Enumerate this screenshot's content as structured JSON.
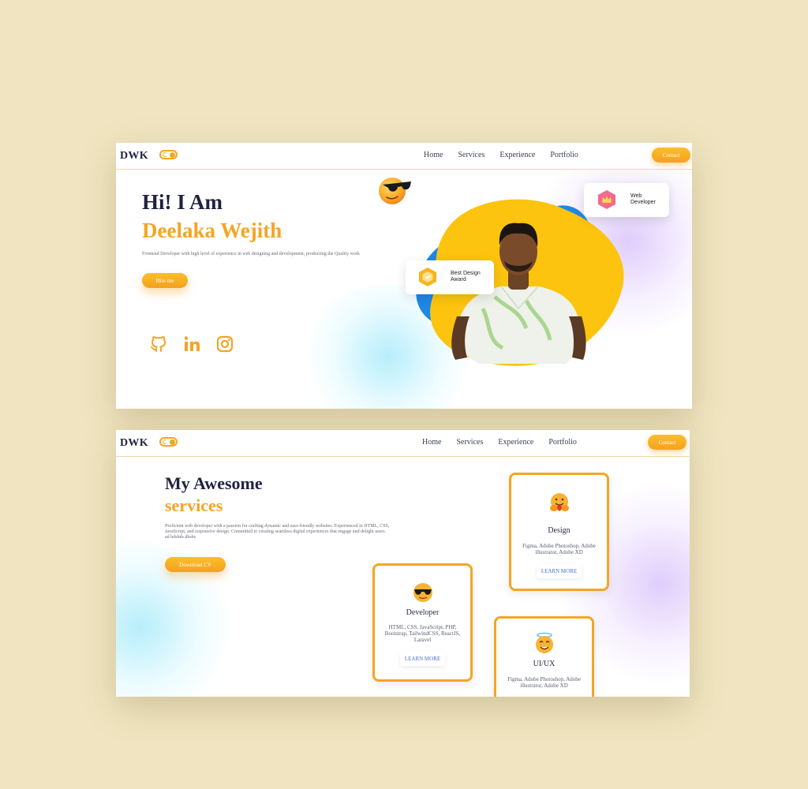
{
  "colors": {
    "accent": "#f5a524",
    "navy": "#1f2240",
    "background": "#f0e5c0",
    "blue_blob": "#1e88e5",
    "yellow_blob": "#fcc40f"
  },
  "hero": {
    "nav": {
      "logo": "DWK",
      "links": [
        "Home",
        "Services",
        "Experience",
        "Portfolio"
      ],
      "contact": "Contact"
    },
    "greeting": "Hi! I Am",
    "name": "Deelaka Wejith",
    "description": "Frontend Developer with high level of experience in web designing and development, producting the Quality work",
    "hire_button": "Hire me",
    "social_icons": [
      "github-icon",
      "linkedin-icon",
      "instagram-icon"
    ],
    "badge_award": "Best Design Award",
    "badge_role": "Web Developer",
    "emoji": "sunglasses-emoji"
  },
  "services": {
    "nav": {
      "logo": "DWK",
      "links": [
        "Home",
        "Services",
        "Experience",
        "Portfolio"
      ],
      "contact": "Contact"
    },
    "heading": "My Awesome",
    "heading_accent": "services",
    "description_line1": "Proficient web developer with a passion for crafting dynamic and user-friendly websites. Experienced in HTML, CSS, JavaScript, and responsive design. Committed to creating seamless digital experiences that engage and delight users.",
    "description_line2": "ad bdsbds dbsbs",
    "cv_button": "Download CV",
    "cards": [
      {
        "title": "Design",
        "text": "Figma, Adobe Photoshop, Adobe illustrator, Adobe XD",
        "button": "LEARN MORE",
        "icon": "hugging-emoji"
      },
      {
        "title": "Developer",
        "text": "HTML, CSS, JavaScript, PHP, Bootstrap, TailwindCSS, ReactJS, Laravel",
        "button": "LEARN MORE",
        "icon": "sunglasses-emoji"
      },
      {
        "title": "UI/UX",
        "text": "Figma, Adobe Photoshop, Adobe illustrator, Adobe XD",
        "icon": "halo-emoji"
      }
    ]
  }
}
